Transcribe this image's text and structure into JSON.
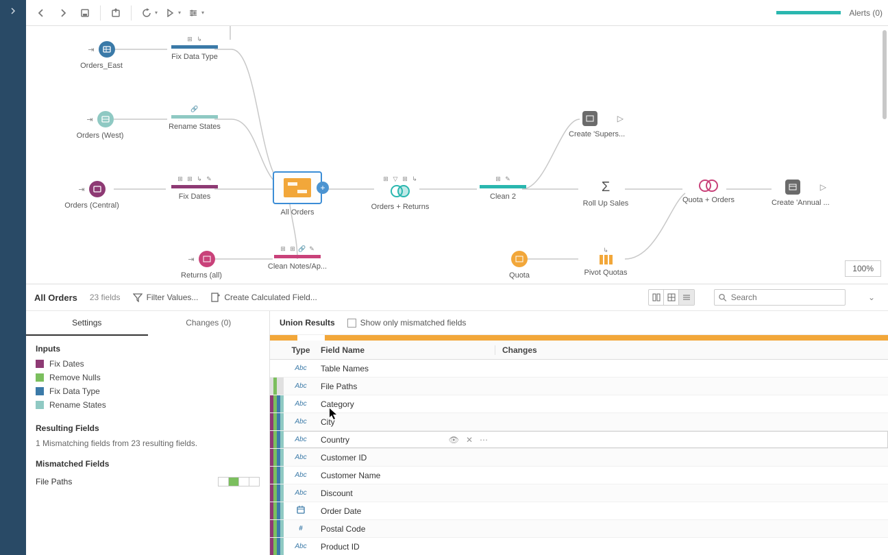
{
  "toolbar": {
    "alerts_label": "Alerts (0)"
  },
  "zoom": "100%",
  "flow": {
    "nodes": {
      "orders_east": "Orders_East",
      "fix_data_type": "Fix Data Type",
      "orders_west": "Orders (West)",
      "rename_states": "Rename States",
      "orders_central": "Orders (Central)",
      "fix_dates": "Fix Dates",
      "all_orders": "All Orders",
      "orders_returns": "Orders + Returns",
      "clean2": "Clean 2",
      "rollup_sales": "Roll Up Sales",
      "quota_orders": "Quota + Orders",
      "create_annual": "Create 'Annual ...",
      "create_supers": "Create 'Supers...",
      "returns_all": "Returns (all)",
      "clean_notes": "Clean Notes/Ap...",
      "quota": "Quota",
      "pivot_quotas": "Pivot Quotas"
    }
  },
  "profile": {
    "title": "All Orders",
    "sub": "23 fields",
    "filter_values": "Filter Values...",
    "create_calc": "Create Calculated Field...",
    "search_placeholder": "Search"
  },
  "left": {
    "tabs": {
      "settings": "Settings",
      "changes": "Changes (0)"
    },
    "inputs_title": "Inputs",
    "inputs": [
      {
        "color": "#8e3a74",
        "label": "Fix Dates"
      },
      {
        "color": "#7bbf5e",
        "label": "Remove Nulls"
      },
      {
        "color": "#3b7aa8",
        "label": "Fix Data Type"
      },
      {
        "color": "#8fc9c3",
        "label": "Rename States"
      }
    ],
    "resulting_title": "Resulting Fields",
    "resulting_note": "1 Mismatching fields from 23 resulting fields.",
    "mismatched_title": "Mismatched Fields",
    "mismatched_item": "File Paths"
  },
  "union": {
    "title": "Union Results",
    "show_mismatch_label": "Show only mismatched fields"
  },
  "columns": {
    "type": "Type",
    "field": "Field Name",
    "changes": "Changes"
  },
  "rows": [
    {
      "type": "Abc",
      "name": "Table Names",
      "stripes": []
    },
    {
      "type": "Abc",
      "name": "File Paths",
      "stripes": [
        "#e0e0e0",
        "#7bbf5e",
        "#e0e0e0",
        "#e0e0e0"
      ]
    },
    {
      "type": "Abc",
      "name": "Category",
      "stripes": [
        "#8e3a74",
        "#7bbf5e",
        "#3b7aa8",
        "#8fc9c3"
      ]
    },
    {
      "type": "Abc",
      "name": "City",
      "stripes": [
        "#8e3a74",
        "#7bbf5e",
        "#3b7aa8",
        "#8fc9c3"
      ]
    },
    {
      "type": "Abc",
      "name": "Country",
      "stripes": [
        "#8e3a74",
        "#7bbf5e",
        "#3b7aa8",
        "#8fc9c3"
      ],
      "hover": true
    },
    {
      "type": "Abc",
      "name": "Customer ID",
      "stripes": [
        "#8e3a74",
        "#7bbf5e",
        "#3b7aa8",
        "#8fc9c3"
      ]
    },
    {
      "type": "Abc",
      "name": "Customer Name",
      "stripes": [
        "#8e3a74",
        "#7bbf5e",
        "#3b7aa8",
        "#8fc9c3"
      ]
    },
    {
      "type": "Abc",
      "name": "Discount",
      "stripes": [
        "#8e3a74",
        "#7bbf5e",
        "#3b7aa8",
        "#8fc9c3"
      ]
    },
    {
      "type": "date",
      "name": "Order Date",
      "stripes": [
        "#8e3a74",
        "#7bbf5e",
        "#3b7aa8",
        "#8fc9c3"
      ]
    },
    {
      "type": "#",
      "name": "Postal Code",
      "stripes": [
        "#8e3a74",
        "#7bbf5e",
        "#3b7aa8",
        "#8fc9c3"
      ]
    },
    {
      "type": "Abc",
      "name": "Product ID",
      "stripes": [
        "#8e3a74",
        "#7bbf5e",
        "#3b7aa8",
        "#8fc9c3"
      ]
    }
  ],
  "colors": {
    "purple": "#8e3a74",
    "green": "#7bbf5e",
    "blue": "#3b7aa8",
    "teal": "#8fc9c3",
    "orange": "#f2a73a",
    "magenta": "#c9427a",
    "dkteal": "#2ab7af"
  }
}
